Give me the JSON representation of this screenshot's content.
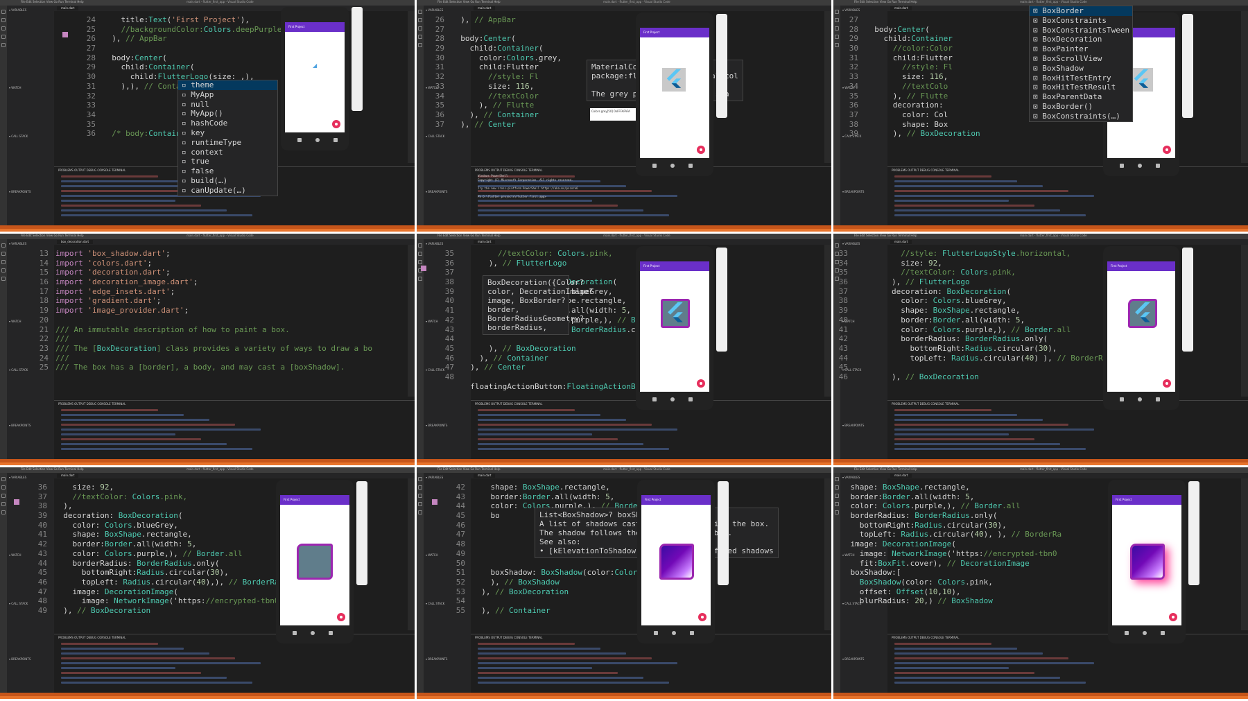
{
  "tiles": [
    {
      "gutter": [
        "24",
        "25",
        "26",
        "27",
        "28",
        "29",
        "30",
        "31",
        "32",
        "33",
        "34",
        "35",
        "36"
      ],
      "code": [
        "    title:Text('First Project'),",
        "    //backgroundColor:Colors.deepPurple ,",
        "  ), // AppBar",
        "",
        "  body:Center(",
        "    child:Container(",
        "      child:FlutterLogo(size: ,),",
        "    ),), // Containe",
        "",
        "",
        "",
        "",
        "  /* body:Container("
      ],
      "popup": [
        "theme",
        "MyApp",
        "null",
        "MyApp()",
        "hashCode",
        "key",
        "runtimeType",
        "context",
        "true",
        "false",
        "build(…)",
        "canUpdate(…)"
      ],
      "app_title": "First Project"
    },
    {
      "gutter": [
        "26",
        "27",
        "28",
        "29",
        "30",
        "31",
        "32",
        "33",
        "34",
        "35",
        "36",
        "37"
      ],
      "code": [
        "  ), // AppBar",
        "",
        "  body:Center(",
        "    child:Container(",
        "      color:Colors.grey,",
        "      child:Flutter",
        "        //style: Fl",
        "        size: 116,",
        "        //textColor",
        "      ), // Flutte",
        "    ), // Container",
        "  ), // Center"
      ],
      "hover": [
        "MaterialColor grey",
        "package:flutter/src/material/col",
        "",
        "The grey primary color and swa"
      ],
      "terminal": [
        "Windows PowerShell",
        "Copyright (C) Microsoft Corporation. All rights reserved.",
        "",
        "Try the new cross-platform PowerShell https://aka.ms/pscore6",
        "",
        "PS D:\\flutter_projects\\flutter_first_app>"
      ],
      "swatch_label": "Colors.grey[50]",
      "swatch_value": "0xFFFAFAFA",
      "app_title": "First Project"
    },
    {
      "gutter": [
        "27",
        "28",
        "29",
        "30",
        "31",
        "32",
        "33",
        "34",
        "35",
        "36",
        "37",
        "38",
        "39"
      ],
      "code": [
        "",
        "  body:Center(",
        "    child:Container",
        "      //color:Color",
        "      child:Flutter",
        "        //style: Fl",
        "        size: 116,",
        "        //textColo",
        "      ), // Flutte",
        "      decoration:",
        "        color: Col",
        "        shape: Box",
        "      ), // BoxDecoration"
      ],
      "popup": [
        "BoxBorder",
        "BoxConstraints",
        "BoxConstraintsTween",
        "BoxDecoration",
        "BoxPainter",
        "BoxScrollView",
        "BoxShadow",
        "BoxHitTestEntry",
        "BoxHitTestResult",
        "BoxParentData",
        "BoxBorder()",
        "BoxConstraints(…)"
      ],
      "app_title": "First Project"
    },
    {
      "gutter": [
        "13",
        "14",
        "15",
        "16",
        "17",
        "18",
        "19",
        "20",
        "21",
        "22",
        "23",
        "24",
        "25"
      ],
      "code": [
        "import 'box_shadow.dart';",
        "import 'colors.dart';",
        "import 'decoration.dart';",
        "import 'decoration_image.dart';",
        "import 'edge_insets.dart';",
        "import 'gradient.dart';",
        "import 'image_provider.dart';",
        "",
        "/// An immutable description of how to paint a box.",
        "///",
        "/// The [BoxDecoration] class provides a variety of ways to draw a bo",
        "///",
        "/// The box has a [border], a body, and may cast a [boxShadow]."
      ],
      "file": "box_decoration.dart"
    },
    {
      "gutter": [
        "35",
        "36",
        "37",
        "38",
        "39",
        "40",
        "41",
        "42",
        "43",
        "44",
        "45",
        "46",
        "47",
        "48"
      ],
      "code": [
        "        //textColor: Colors.pink,",
        "      ), // FlutterLogo",
        "",
        "                    BoxDecoration(",
        "                    ors.blueGrey,",
        "                    Shape.rectangle,",
        "                    der.all(width: 5,",
        "                    ors.purple,), // Border.all",
        "                    us: BorderRadius.circular(20)",
        "",
        "      ), // BoxDecoration",
        "    ), // Container",
        "  ), // Center",
        "",
        "  floatingActionButton:FloatingActionButton("
      ],
      "hover": [
        "BoxDecoration({Color?",
        "color, DecorationImage?",
        "image, BoxBorder?",
        "border,",
        "BorderRadiusGeometry?",
        "borderRadius,"
      ],
      "app_title": "First Project"
    },
    {
      "gutter": [
        "33",
        "34",
        "35",
        "36",
        "37",
        "38",
        "39",
        "40",
        "41",
        "42",
        "43",
        "44",
        "45",
        "46"
      ],
      "code": [
        "          //style: FlutterLogoStyle.horizontal,",
        "          size: 92,",
        "          //textColor: Colors.pink,",
        "        ), // FlutterLogo",
        "        decoration: BoxDecoration(",
        "          color: Colors.blueGrey,",
        "          shape: BoxShape.rectangle,",
        "          border:Border.all(width: 5,",
        "          color: Colors.purple,), // Border.all",
        "          borderRadius: BorderRadius.only(",
        "            bottomRight:Radius.circular(30),",
        "            topLeft: Radius.circular(40) ), // BorderRa",
        "",
        "        ), // BoxDecoration"
      ],
      "app_title": "First Project"
    },
    {
      "gutter": [
        "36",
        "37",
        "38",
        "39",
        "40",
        "41",
        "42",
        "43",
        "44",
        "45",
        "46",
        "47",
        "48",
        "49"
      ],
      "code": [
        "    size: 92,",
        "    //textColor: Colors.pink,",
        "  ),",
        "  decoration: BoxDecoration(",
        "    color: Colors.blueGrey,",
        "    shape: BoxShape.rectangle,",
        "    border:Border.all(width: 5,",
        "    color: Colors.purple,), // Border.all",
        "    borderRadius: BorderRadius.only(",
        "      bottomRight:Radius.circular(30),",
        "      topLeft: Radius.circular(40),), // BorderRadius.only",
        "    image: DecorationImage(",
        "      image: NetworkImage('https://encrypted-tbn0.gstatic.c",
        "  ), // BoxDecoration"
      ],
      "app_title": "First Project"
    },
    {
      "gutter": [
        "42",
        "43",
        "44",
        "45",
        "46",
        "47",
        "48",
        "49",
        "50",
        "51",
        "52",
        "53",
        "54",
        "55"
      ],
      "code": [
        "    shape: BoxShape.rectangle,",
        "    border:Border.all(width: 5,",
        "    color: Colors.purple,), // Border.all",
        "    bo",
        "",
        "",
        "",
        "",
        "",
        "    boxShadow: BoxShadow(color:Colors.pink,",
        "    ), // BoxShadow",
        "  ), // BoxDecoration",
        "",
        "  ), // Container"
      ],
      "hover": [
        "List<BoxShadow>? boxShadow}",
        "A list of shadows cast by this box behind the box.",
        "The shadow follows the [shape] of the box.",
        "See also:",
        "• [kElevationToShadow], for some predefined shadows"
      ],
      "app_title": "First Project"
    },
    {
      "gutter": [
        "41",
        "42",
        "43",
        "44",
        "45",
        "46",
        "47",
        "48",
        "49",
        "50",
        "51",
        "52",
        "53",
        "54"
      ],
      "code": [
        "    shape: BoxShape.rectangle,",
        "    border:Border.all(width: 5,",
        "    color: Colors.purple,), // Border.all",
        "    borderRadius: BorderRadius.only(",
        "      bottomRight:Radius.circular(30),",
        "      topLeft: Radius.circular(40), ), // BorderRa",
        "    image: DecorationImage(",
        "      image: NetworkImage('https://encrypted-tbn0",
        "      fit:BoxFit.cover), // DecorationImage",
        "    boxShadow:[",
        "      BoxShadow(color: Colors.pink,",
        "      offset: Offset(10,10),",
        "      blurRadius: 20,) // BoxShadow",
        ""
      ],
      "app_title": "First Project"
    }
  ],
  "ui": {
    "menu": "File  Edit  Selection  View  Go  Run  Terminal  Help",
    "window_title": "main.dart - flutter_first_app - Visual Studio Code",
    "tab": "main.dart",
    "panel_tabs": "PROBLEMS   OUTPUT   DEBUG CONSOLE   TERMINAL",
    "sidebar_headers": [
      "VARIABLES",
      "WATCH",
      "CALL STACK",
      "BREAKPOINTS"
    ]
  },
  "colors": {
    "accent": "#e8742c",
    "appbar": "#6a2fc9",
    "fab": "#e62e5c",
    "bluegrey": "#607d8b",
    "purple": "#9c27b0"
  }
}
